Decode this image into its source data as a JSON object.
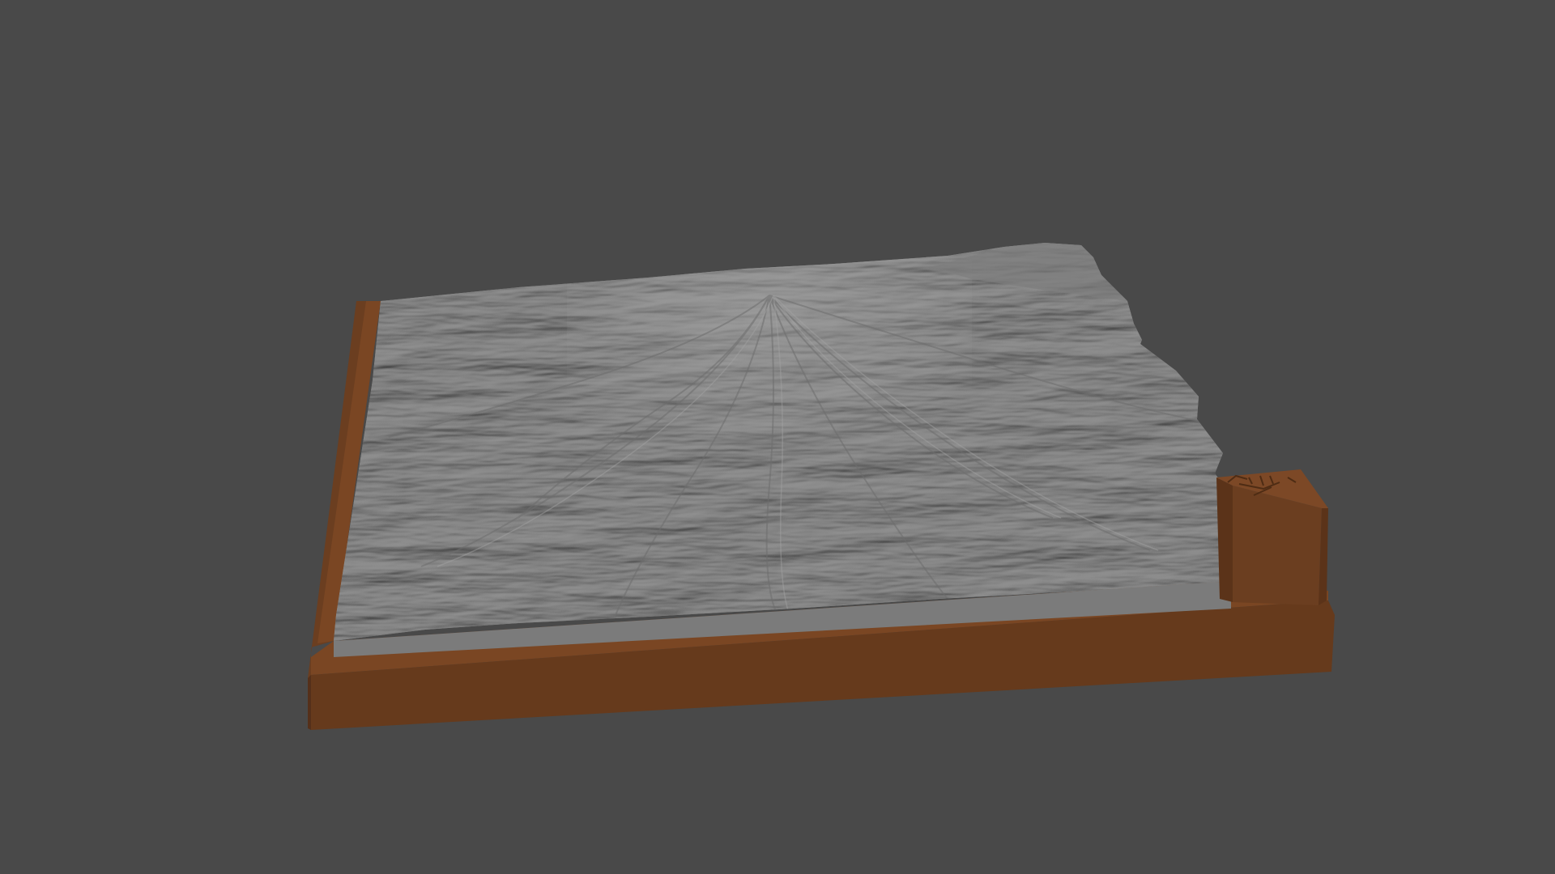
{
  "viewport": {
    "background_color": "#494949"
  },
  "model": {
    "subject": "terrain-relief-model",
    "terrain_color": "#8f8f8f",
    "terrain_side_color": "#7a7a7a",
    "base_color": "#6b3e20",
    "base_side_color": "#5e361b",
    "tag_block_color": "#6b3e20"
  }
}
